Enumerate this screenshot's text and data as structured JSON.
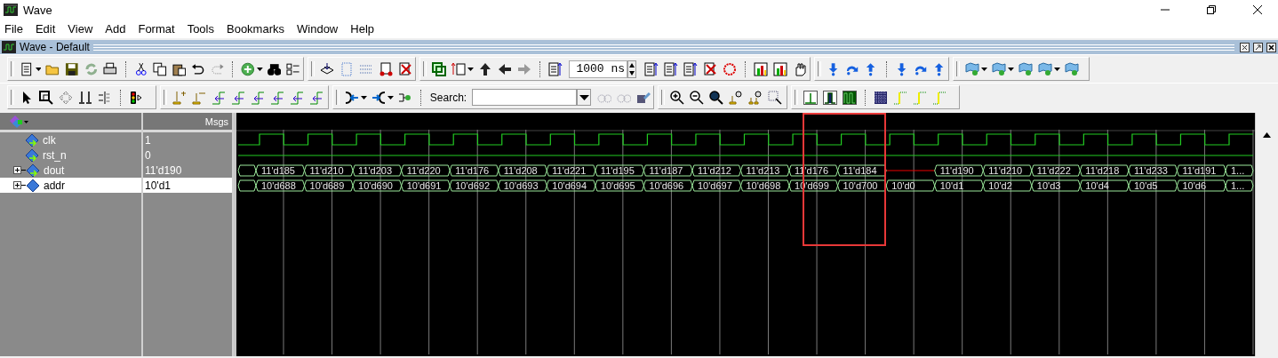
{
  "window": {
    "title": "Wave"
  },
  "menu": [
    {
      "label": "File"
    },
    {
      "label": "Edit"
    },
    {
      "label": "View"
    },
    {
      "label": "Add"
    },
    {
      "label": "Format"
    },
    {
      "label": "Tools"
    },
    {
      "label": "Bookmarks"
    },
    {
      "label": "Window"
    },
    {
      "label": "Help"
    }
  ],
  "pane": {
    "title": "Wave - Default"
  },
  "toolbar": {
    "time_field": {
      "value": "1000 ns"
    },
    "search": {
      "label": "Search:"
    }
  },
  "wave": {
    "value_header": "Msgs",
    "signals": [
      {
        "name": "clk",
        "value": "1",
        "kind": "clock",
        "selected": false
      },
      {
        "name": "rst_n",
        "value": "0",
        "kind": "constant",
        "selected": false
      },
      {
        "name": "dout",
        "value": "11'd190",
        "kind": "bus",
        "expanded": false,
        "selected": false,
        "segments": [
          {
            "kind": "blank"
          },
          {
            "kind": "value",
            "value": "11'd185"
          },
          {
            "kind": "value",
            "value": "11'd210"
          },
          {
            "kind": "value",
            "value": "11'd203"
          },
          {
            "kind": "value",
            "value": "11'd220"
          },
          {
            "kind": "value",
            "value": "11'd176"
          },
          {
            "kind": "value",
            "value": "11'd208"
          },
          {
            "kind": "value",
            "value": "11'd221"
          },
          {
            "kind": "value",
            "value": "11'd195"
          },
          {
            "kind": "value",
            "value": "11'd187"
          },
          {
            "kind": "value",
            "value": "11'd212"
          },
          {
            "kind": "value",
            "value": "11'd213"
          },
          {
            "kind": "value",
            "value": "11'd176"
          },
          {
            "kind": "value",
            "value": "11'd184"
          },
          {
            "kind": "undefined"
          },
          {
            "kind": "value",
            "value": "11'd190"
          },
          {
            "kind": "value",
            "value": "11'd210"
          },
          {
            "kind": "value",
            "value": "11'd222"
          },
          {
            "kind": "value",
            "value": "11'd218"
          },
          {
            "kind": "value",
            "value": "11'd233"
          },
          {
            "kind": "value",
            "value": "11'd191"
          },
          {
            "kind": "value",
            "value": "1..."
          }
        ]
      },
      {
        "name": "addr",
        "value": "10'd1",
        "kind": "bus",
        "expanded": false,
        "selected": true,
        "segments": [
          {
            "kind": "blank"
          },
          {
            "kind": "value",
            "value": "10'd688"
          },
          {
            "kind": "value",
            "value": "10'd689"
          },
          {
            "kind": "value",
            "value": "10'd690"
          },
          {
            "kind": "value",
            "value": "10'd691"
          },
          {
            "kind": "value",
            "value": "10'd692"
          },
          {
            "kind": "value",
            "value": "10'd693"
          },
          {
            "kind": "value",
            "value": "10'd694"
          },
          {
            "kind": "value",
            "value": "10'd695"
          },
          {
            "kind": "value",
            "value": "10'd696"
          },
          {
            "kind": "value",
            "value": "10'd697"
          },
          {
            "kind": "value",
            "value": "10'd698"
          },
          {
            "kind": "value",
            "value": "10'd699"
          },
          {
            "kind": "value",
            "value": "10'd700"
          },
          {
            "kind": "value",
            "value": "10'd0"
          },
          {
            "kind": "value",
            "value": "10'd1"
          },
          {
            "kind": "value",
            "value": "10'd2"
          },
          {
            "kind": "value",
            "value": "10'd3"
          },
          {
            "kind": "value",
            "value": "10'd4"
          },
          {
            "kind": "value",
            "value": "10'd5"
          },
          {
            "kind": "value",
            "value": "10'd6"
          },
          {
            "kind": "value",
            "value": "1..."
          }
        ]
      }
    ]
  },
  "highlight": {
    "kind": "rectangle"
  }
}
